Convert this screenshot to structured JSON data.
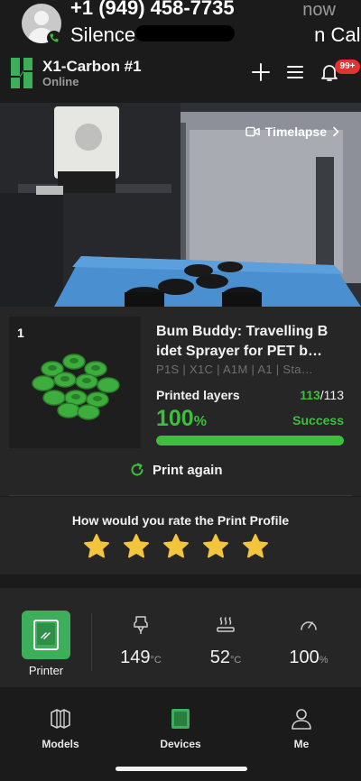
{
  "call_banner": {
    "phone_number": "+1 (949) 458-7735",
    "status_text": "Silence         n Call",
    "time": "now"
  },
  "header": {
    "device_name": "X1-Carbon #1",
    "device_status": "Online",
    "notification_badge": "99+",
    "icons": [
      "add-icon",
      "menu-icon",
      "bell-icon"
    ]
  },
  "camera": {
    "timelapse_label": "Timelapse"
  },
  "job": {
    "plate_number": "1",
    "title": "Bum Buddy: Travelling B idet Sprayer for PET b…",
    "compatible_printers": "P1S | X1C | A1M | A1 | Sta…",
    "layers_label": "Printed layers",
    "layers_current": "113",
    "layers_total": "/113",
    "progress_value": "100",
    "progress_unit": "%",
    "progress_fraction": 1.0,
    "status": "Success",
    "print_again_label": "Print again"
  },
  "rating": {
    "question": "How would you rate the Print Profile",
    "stars": 5,
    "star_color": "#f3c53c"
  },
  "printer_status": {
    "printer_label": "Printer",
    "nozzle_temp": "149",
    "nozzle_unit": "°C",
    "bed_temp": "52",
    "bed_unit": "°C",
    "fan_speed": "100",
    "fan_unit": "%"
  },
  "bottom_nav": {
    "items": [
      {
        "label": "Models",
        "icon": "models-icon"
      },
      {
        "label": "Devices",
        "icon": "devices-icon"
      },
      {
        "label": "Me",
        "icon": "me-icon"
      }
    ]
  },
  "colors": {
    "accent_green": "#3dbf3d",
    "badge_red": "#e33232",
    "background": "#1b1b1b",
    "card": "#262626"
  }
}
